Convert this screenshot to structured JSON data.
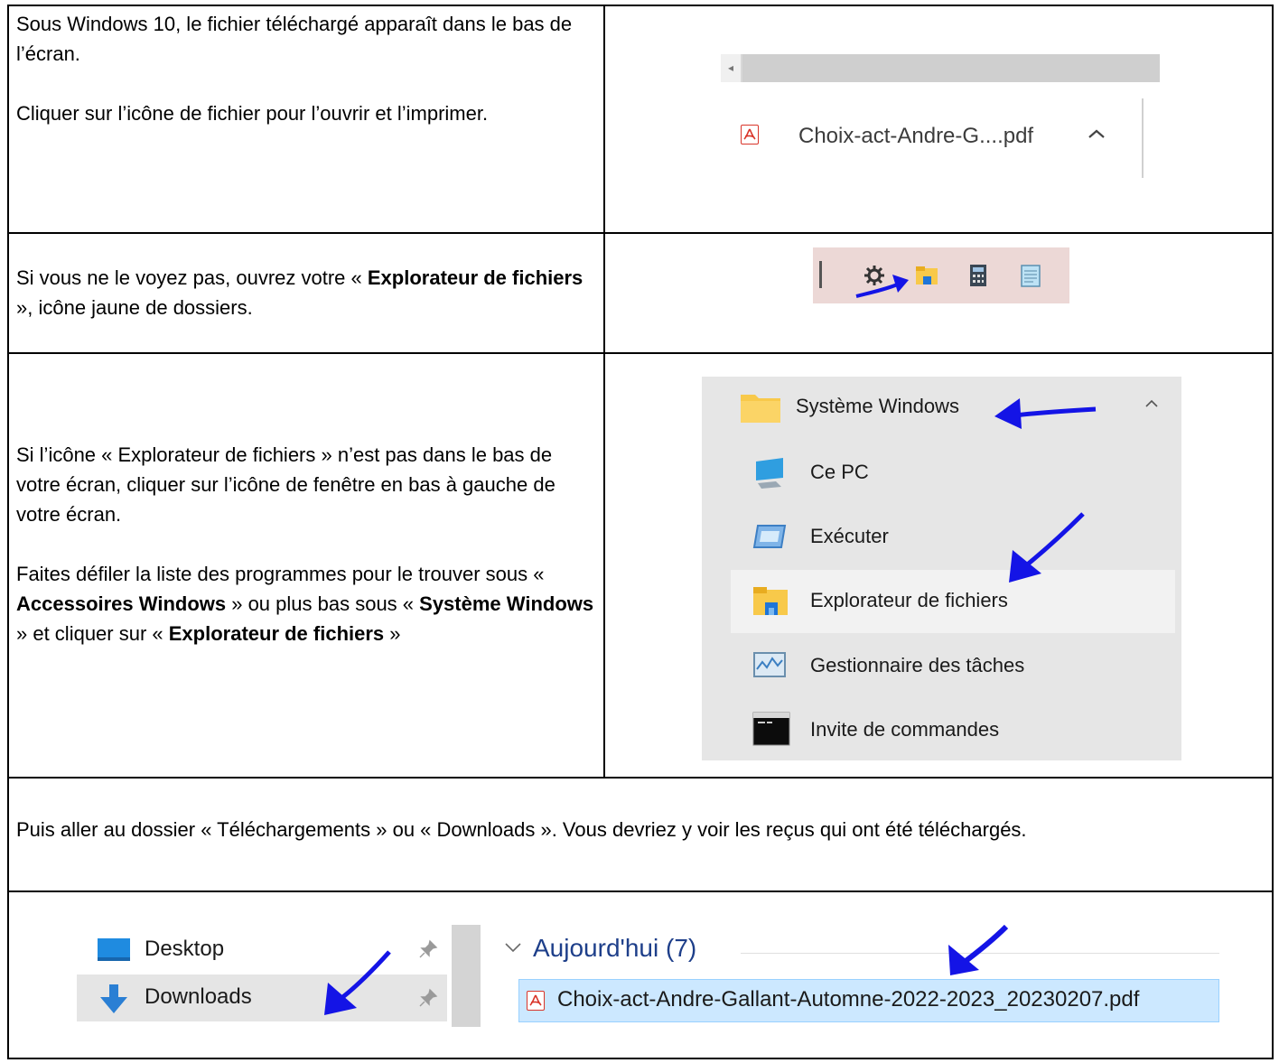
{
  "row1": {
    "text1": "Sous Windows 10, le fichier téléchargé apparaît dans le bas de l’écran.",
    "text2": "Cliquer sur l’icône de fichier pour l’ouvrir et l’imprimer.",
    "download_name": "Choix-act-Andre-G....pdf"
  },
  "row2": {
    "prefix": "Si vous ne le voyez pas, ouvrez votre « ",
    "bold": "Explorateur de fichiers",
    "suffix": " », icône jaune de dossiers."
  },
  "row3": {
    "para1": "Si l’icône « Explorateur de fichiers » n’est pas dans le bas de votre écran, cliquer sur l’icône de fenêtre en bas à gauche de votre écran.",
    "p2_a": "Faites défiler la liste des programmes pour le trouver sous « ",
    "p2_b1": "Accessoires Windows",
    "p2_c": " » ou plus bas sous « ",
    "p2_b2": "Système Windows",
    "p2_d": " » et cliquer sur « ",
    "p2_b3": "Explorateur de fichiers",
    "p2_e": " »",
    "menu": {
      "group": "Système Windows",
      "items": [
        "Ce PC",
        "Exécuter",
        "Explorateur de fichiers",
        "Gestionnaire des tâches",
        "Invite de commandes"
      ]
    }
  },
  "row4": {
    "text": "Puis aller au dossier « Téléchargements » ou « Downloads ». Vous devriez y voir les reçus qui ont été téléchargés."
  },
  "row5": {
    "nav": [
      "Desktop",
      "Downloads"
    ],
    "group_header": "Aujourd'hui (7)",
    "file_name": "Choix-act-Andre-Gallant-Automne-2022-2023_20230207.pdf"
  },
  "colors": {
    "arrow": "#1414e6",
    "pdf_red": "#d9352a",
    "folder_yellow": "#f8c94a",
    "selection_blue": "#cce8ff"
  }
}
